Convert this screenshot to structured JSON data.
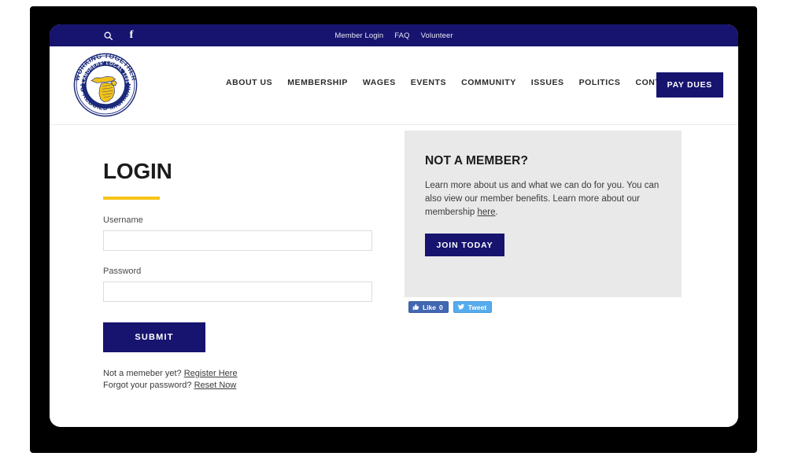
{
  "topbar": {
    "icons": [
      {
        "name": "search-icon",
        "label": "Search"
      },
      {
        "name": "facebook-icon",
        "label": "f"
      }
    ],
    "links": [
      {
        "label": "Member Login"
      },
      {
        "label": "FAQ"
      },
      {
        "label": "Volunteer"
      }
    ],
    "background": "#16146e"
  },
  "logo": {
    "outer_text_top": "WORKING TOGETHER",
    "outer_text_bottom": "TO REBUILD MICHIGAN",
    "inner_text": "LABORERS' LOCAL 1191",
    "shape": "michigan-state-outline",
    "ring_color": "#1b2a7a",
    "state_color": "#f2c317"
  },
  "nav": {
    "items": [
      {
        "label": "ABOUT US"
      },
      {
        "label": "MEMBERSHIP"
      },
      {
        "label": "WAGES"
      },
      {
        "label": "EVENTS"
      },
      {
        "label": "COMMUNITY"
      },
      {
        "label": "ISSUES"
      },
      {
        "label": "POLITICS"
      },
      {
        "label": "CONTACT"
      }
    ],
    "cta_label": "PAY DUES"
  },
  "login": {
    "title": "LOGIN",
    "accent_color": "#f5c518",
    "username": {
      "label": "Username",
      "value": "",
      "placeholder": ""
    },
    "password": {
      "label": "Password",
      "value": "",
      "placeholder": ""
    },
    "submit_label": "SUBMIT",
    "register_prompt": "Not a memeber yet? ",
    "register_link": "Register Here",
    "forgot_prompt": "Forgot your password? ",
    "forgot_link": "Reset Now"
  },
  "member_panel": {
    "title": "NOT A MEMBER?",
    "body_part1": "Learn more about us and what we can do for you. You can also view our member benefits. Learn more about our membership ",
    "body_link": "here",
    "body_part2": ".",
    "button_label": "JOIN TODAY",
    "background": "#e9e9e9"
  },
  "share": {
    "facebook": {
      "label": "Like",
      "count": "0",
      "color": "#4267b2"
    },
    "twitter": {
      "label": "Tweet",
      "color": "#55acee"
    }
  }
}
